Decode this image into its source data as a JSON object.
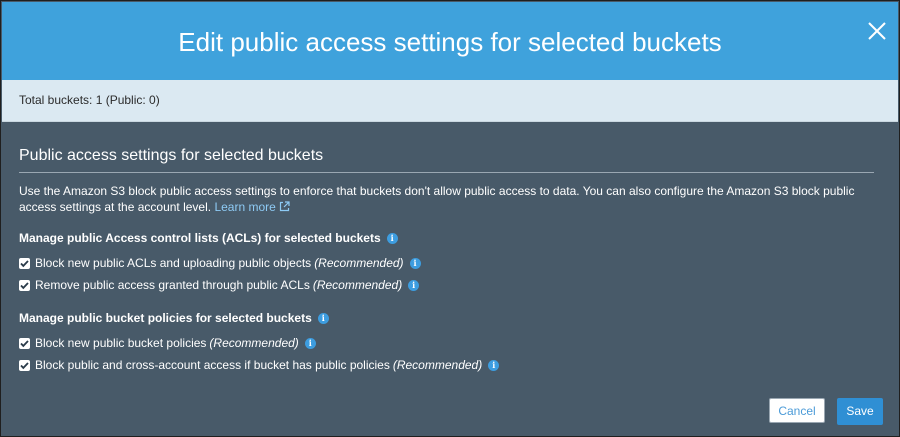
{
  "modal": {
    "title": "Edit public access settings for selected buckets",
    "close_icon": "close-icon"
  },
  "summary": {
    "total_buckets": "Total buckets: 1 (Public: 0)"
  },
  "section": {
    "title": "Public access settings for selected buckets",
    "description": "Use the Amazon S3 block public access settings to enforce that buckets don't allow public access to data. You can also configure the Amazon S3 block public access settings at the account level.",
    "learn_more": "Learn more"
  },
  "acl_group": {
    "title": "Manage public Access control lists (ACLs) for selected buckets",
    "options": [
      {
        "label": "Block new public ACLs and uploading public objects",
        "note": "(Recommended)",
        "checked": true
      },
      {
        "label": "Remove public access granted through public ACLs",
        "note": "(Recommended)",
        "checked": true
      }
    ]
  },
  "policy_group": {
    "title": "Manage public bucket policies for selected buckets",
    "options": [
      {
        "label": "Block new public bucket policies",
        "note": "(Recommended)",
        "checked": true
      },
      {
        "label": "Block public and cross-account access if bucket has public policies",
        "note": "(Recommended)",
        "checked": true
      }
    ]
  },
  "footer": {
    "cancel_label": "Cancel",
    "save_label": "Save"
  },
  "colors": {
    "header_bg": "#3fa2dc",
    "body_bg": "#485a69",
    "infobar_bg": "#dbe9f2",
    "accent_blue": "#2f8fd4",
    "link": "#8ecbf5"
  }
}
